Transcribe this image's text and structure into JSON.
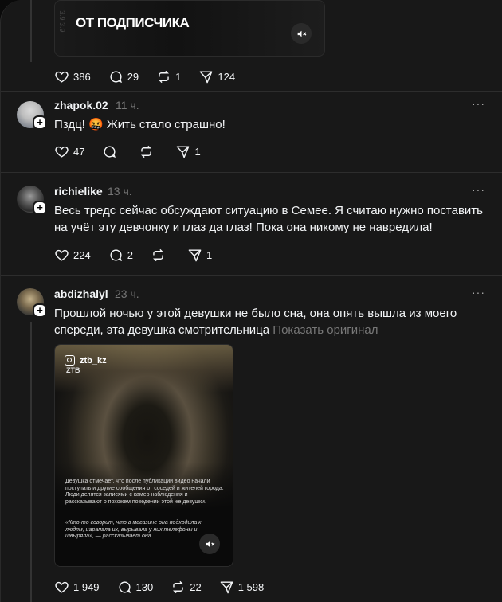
{
  "top_post": {
    "media_title": "ОТ ПОДПИСЧИКА",
    "media_edge_text": "3.9 3.9",
    "stats": {
      "likes": "386",
      "replies": "29",
      "reposts": "1",
      "shares": "124"
    }
  },
  "posts": [
    {
      "username": "zhapok.02",
      "time": "11 ч.",
      "text": "Пздц! 🤬 Жить стало страшно!",
      "stats": {
        "likes": "47",
        "replies": "",
        "reposts": "",
        "shares": "1"
      }
    },
    {
      "username": "richielike",
      "time": "13 ч.",
      "text_line1": "Весь тредс сейчас обсуждают ситуацию в Семее. Я считаю нужно поставить",
      "text_line2": "на учёт эту девчонку и глаз да глаз! Пока она никому не навредила!",
      "stats": {
        "likes": "224",
        "replies": "2",
        "reposts": "",
        "shares": "1"
      }
    },
    {
      "username": "abdizhalyl",
      "time": "23 ч.",
      "text_line1": "Прошлой ночью у этой девушки не было сна, она опять вышла из моего",
      "text_line2": "спереди, эта девушка смотрительница",
      "show_original": "Показать оригинал",
      "media": {
        "handle": "ztb_kz",
        "logo": "ZTB",
        "caption": "Девушка отмечает, что после публикации видео начали поступать и другие сообщения от соседей и жителей города. Люди делятся записями с камер наблюдения и рассказывают о похожем поведении этой же девушки.",
        "quote": "«Кто-то говорит, что в магазине она подходила к людям, царапала их, вырывала у них телефоны и швыряла», — рассказывает она."
      },
      "stats": {
        "likes": "1 949",
        "replies": "130",
        "reposts": "22",
        "shares": "1 598"
      }
    }
  ],
  "more_label": "···",
  "plus_label": "+",
  "icons": {
    "like": "heart-icon",
    "reply": "comment-icon",
    "repost": "repost-icon",
    "share": "send-icon",
    "mute": "volume-mute-icon"
  }
}
